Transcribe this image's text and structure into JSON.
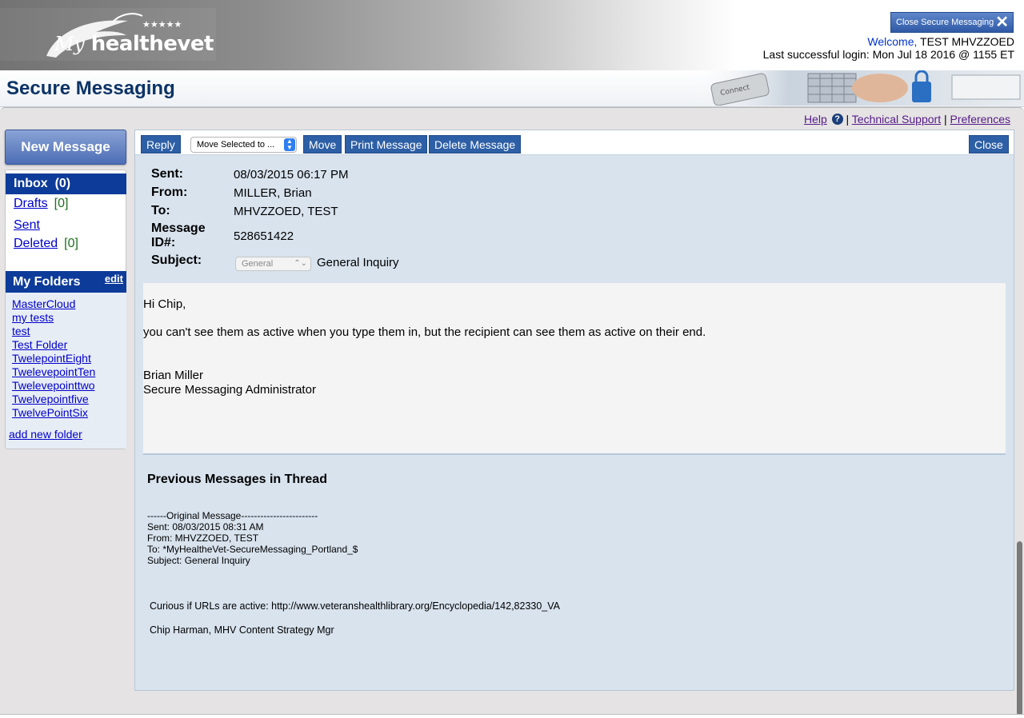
{
  "header": {
    "logo_my": "My",
    "logo_text": "healthevet",
    "close_button": "Close Secure Messaging",
    "welcome_label": "Welcome,",
    "user_name": "TEST MHVZZOED",
    "last_login": "Last successful login: Mon Jul 18 2016 @ 1155 ET"
  },
  "page_title": "Secure Messaging",
  "utility_links": {
    "help": "Help",
    "help_icon": "?",
    "sep1": "|",
    "technical_support": "Technical Support",
    "sep2": "|",
    "preferences": "Preferences"
  },
  "sidebar": {
    "new_message": "New Message",
    "inbox": "Inbox",
    "inbox_count": "(0)",
    "drafts": "Drafts",
    "drafts_count": "[0]",
    "sent": "Sent",
    "deleted": "Deleted",
    "deleted_count": "[0]",
    "my_folders": "My Folders",
    "edit": "edit",
    "folders": [
      "MasterCloud",
      "my tests",
      "test",
      "Test Folder",
      "TwelepointEight",
      "TwelevepointTen",
      "Twelevepointtwo",
      "Twelvepointfive",
      "TwelvePointSix"
    ],
    "add_new_folder": "add new folder"
  },
  "toolbar": {
    "reply": "Reply",
    "move_select": "Move Selected to ...",
    "move": "Move",
    "print_message": "Print Message",
    "delete_message": "Delete Message",
    "close": "Close"
  },
  "message": {
    "sent_label": "Sent:",
    "sent_value": "08/03/2015 06:17 PM",
    "from_label": "From:",
    "from_value": "MILLER, Brian",
    "to_label": "To:",
    "to_value": "MHVZZOED, TEST",
    "id_label_1": "Message",
    "id_label_2": "ID#:",
    "id_value": "528651422",
    "subject_label": "Subject:",
    "subject_category": "General",
    "subject_value": "General Inquiry",
    "body": [
      "Hi Chip,",
      "you can't see them as active when you type them in, but the recipient can see them as active on their end.",
      "Brian Miller",
      "Secure Messaging Administrator"
    ]
  },
  "thread": {
    "title": "Previous Messages in Thread",
    "original_header": [
      "------Original Message------------------------",
      "Sent: 08/03/2015 08:31 AM",
      "From: MHVZZOED, TEST",
      "To: *MyHealtheVet-SecureMessaging_Portland_$",
      "Subject: General Inquiry"
    ],
    "original_body": [
      "Curious if URLs are active:  http://www.veteranshealthlibrary.org/Encyclopedia/142,82330_VA",
      "Chip Harman, MHV Content Strategy Mgr"
    ]
  }
}
